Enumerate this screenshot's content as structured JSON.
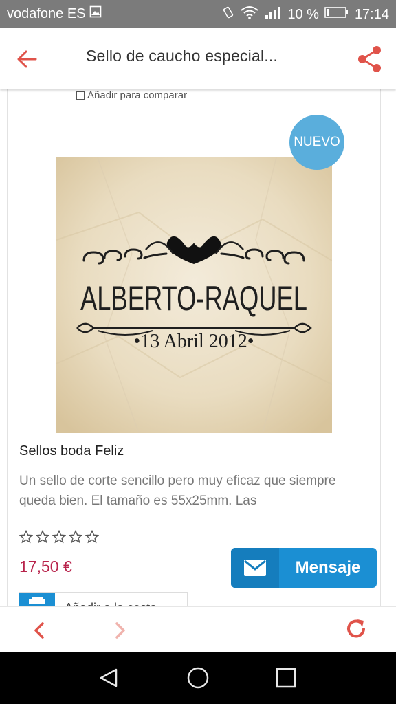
{
  "statusbar": {
    "carrier": "vodafone ES",
    "battery": "10 %",
    "time": "17:14"
  },
  "appbar": {
    "title": "Sello de caucho especial..."
  },
  "previous_card": {
    "compare_label": "Añadir para comparar"
  },
  "product": {
    "badge": "NUEVO",
    "stamp_name": "ALBERTO-RAQUEL",
    "stamp_date": "•13 Abril 2012•",
    "title": "Sellos boda Feliz",
    "description": "Un sello de corte sencillo pero muy eficaz que siempre queda bien. El tamaño es 55x25mm. Las",
    "rating": 0,
    "rating_max": 5,
    "price": "17,50 €",
    "message_button": "Mensaje",
    "cart_button": "Añadir a la cesta"
  },
  "colors": {
    "accent": "#e0534a",
    "message_blue": "#1b8fd3",
    "price": "#b8234b",
    "badge": "#5aaedc"
  },
  "icons": {
    "back": "arrow-left-icon",
    "share": "share-icon",
    "nav_back": "chevron-left-icon",
    "nav_forward": "chevron-right-icon",
    "reload": "reload-icon",
    "mail": "mail-icon",
    "cart": "cart-icon"
  }
}
